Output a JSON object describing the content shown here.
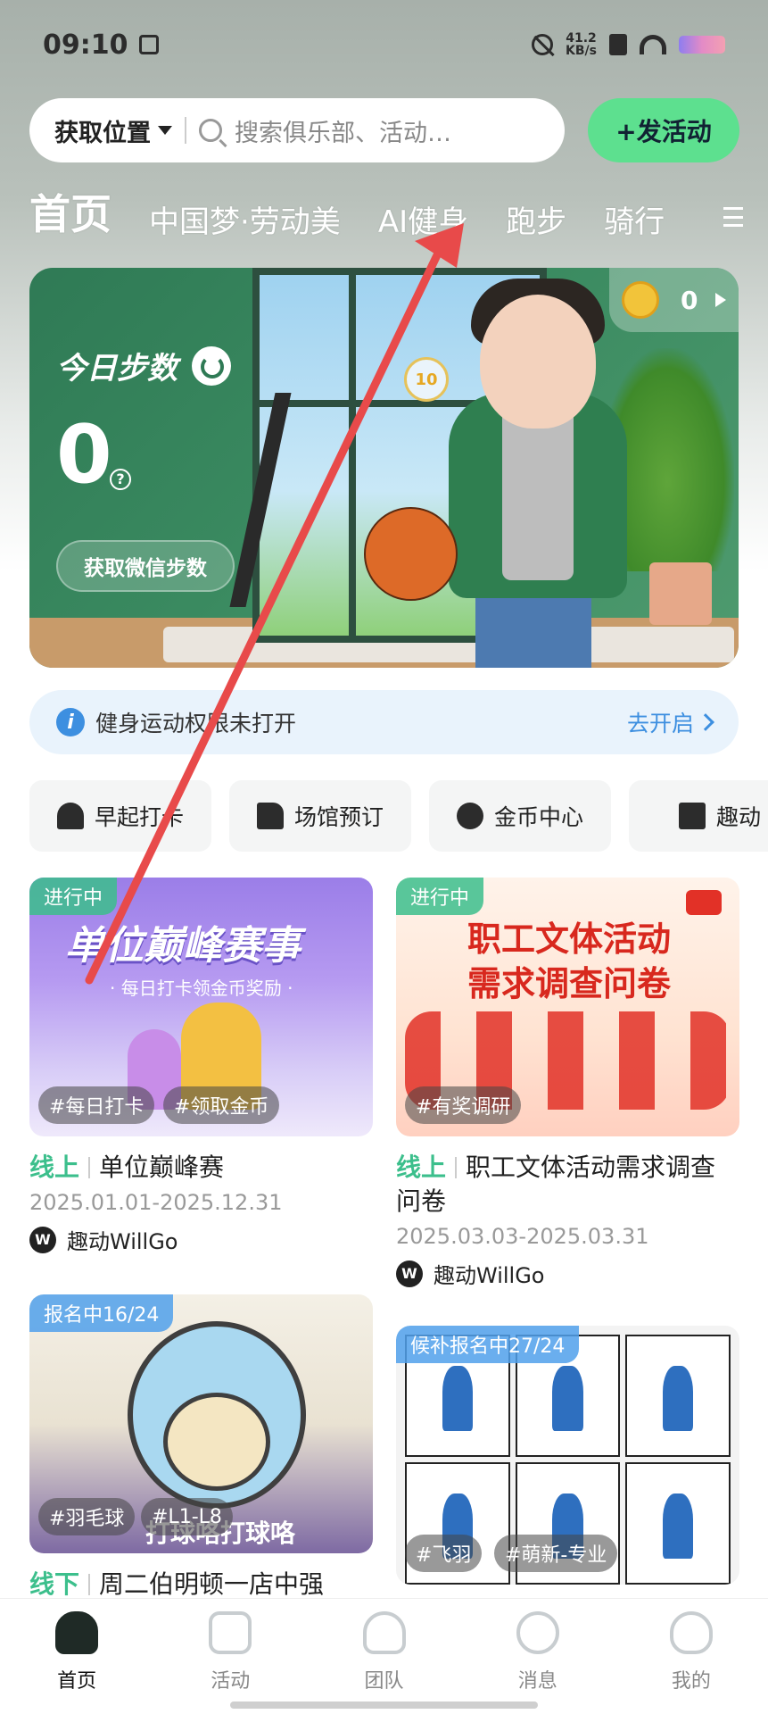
{
  "status_bar": {
    "time": "09:10",
    "net_speed_value": "41.2",
    "net_speed_unit": "KB/s"
  },
  "search": {
    "location_label": "获取位置",
    "placeholder": "搜索俱乐部、活动…",
    "post_button": "+发活动"
  },
  "tabs": [
    "首页",
    "中国梦·劳动美",
    "AI健身",
    "跑步",
    "骑行"
  ],
  "hero": {
    "steps_label": "今日步数",
    "steps_value": "0",
    "wechat_button": "获取微信步数",
    "coin_count": "0",
    "float_coin_value": "10"
  },
  "notice": {
    "text": "健身运动权限未打开",
    "link": "去开启"
  },
  "shortcuts": [
    "早起打卡",
    "场馆预订",
    "金币中心",
    "趣动"
  ],
  "cards": [
    {
      "badge": "进行中",
      "image_headline": "单位巅峰赛事",
      "image_sub": "· 每日打卡领金币奖励 ·",
      "tags": [
        "#每日打卡",
        "#领取金币"
      ],
      "mode": "线上",
      "title": "单位巅峰赛",
      "date": "2025.01.01-2025.12.31",
      "org": "趣动WillGo"
    },
    {
      "badge": "进行中",
      "image_line1": "职工文体活动",
      "image_line2": "需求调查问卷",
      "tags": [
        "#有奖调研"
      ],
      "mode": "线上",
      "title": "职工文体活动需求调查问卷",
      "date": "2025.03.03-2025.03.31",
      "org": "趣动WillGo"
    },
    {
      "badge": "报名中16/24",
      "image_caption": "打球咯打球咯",
      "tags": [
        "#羽毛球",
        "#L1-L8"
      ],
      "mode": "线下",
      "title": "周二伯明顿一店中强"
    },
    {
      "badge": "候补报名中27/24",
      "tags": [
        "#飞羽",
        "#萌新-专业"
      ]
    }
  ],
  "bottom_nav": [
    "首页",
    "活动",
    "团队",
    "消息",
    "我的"
  ],
  "colors": {
    "accent_green": "#5de08f",
    "mode_green": "#3cbf8c",
    "link_blue": "#3d8fe0",
    "arrow_red": "#e84a4a"
  }
}
